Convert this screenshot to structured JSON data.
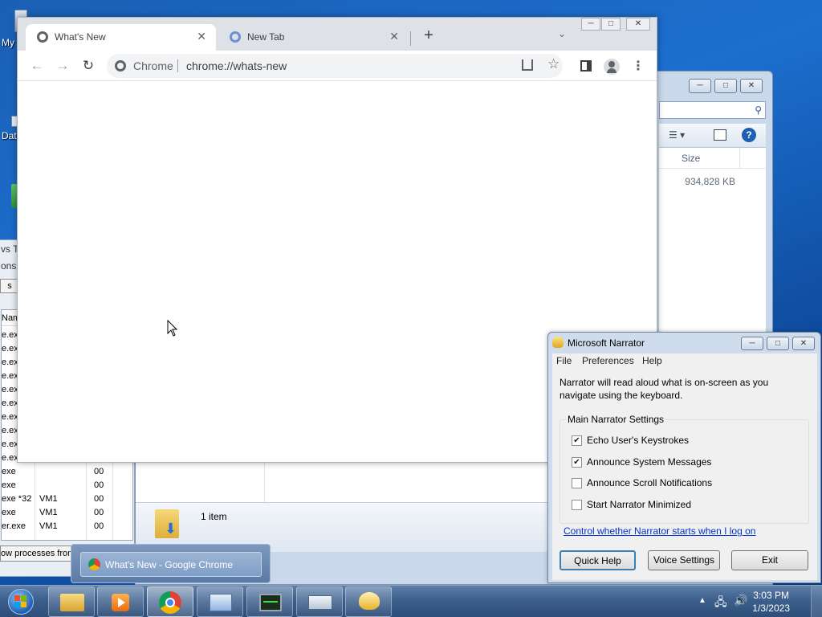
{
  "desktop": {
    "icon_labels": [
      "My",
      "Dat"
    ]
  },
  "task_manager": {
    "title_fragment": "vs Ta",
    "tab_fragment": "ons",
    "button_fragment": "s",
    "column_header": "Nam",
    "rows": [
      {
        "name": "e.exe",
        "user": "",
        "cpu": ""
      },
      {
        "name": "e.exe",
        "user": "",
        "cpu": ""
      },
      {
        "name": "e.exe",
        "user": "",
        "cpu": ""
      },
      {
        "name": "e.exe",
        "user": "",
        "cpu": ""
      },
      {
        "name": "e.exe",
        "user": "",
        "cpu": ""
      },
      {
        "name": "e.exe",
        "user": "",
        "cpu": ""
      },
      {
        "name": "e.exe",
        "user": "",
        "cpu": ""
      },
      {
        "name": "e.exe",
        "user": "",
        "cpu": ""
      },
      {
        "name": "e.exe",
        "user": "",
        "cpu": ""
      },
      {
        "name": "e.exe",
        "user": "",
        "cpu": ""
      },
      {
        "name": "exe",
        "user": "",
        "cpu": "00"
      },
      {
        "name": "exe",
        "user": "",
        "cpu": "00"
      },
      {
        "name": "exe *32",
        "user": "VM1",
        "cpu": "00"
      },
      {
        "name": "exe",
        "user": "VM1",
        "cpu": "00"
      },
      {
        "name": "er.exe",
        "user": "VM1",
        "cpu": "00"
      }
    ],
    "show_processes_label": "ow processes from"
  },
  "explorer": {
    "column_size": "Size",
    "file_size": "934,828 KB",
    "status_items": "1 item"
  },
  "chrome": {
    "tabs": [
      {
        "title": "What's New",
        "active": true
      },
      {
        "title": "New Tab",
        "active": false
      }
    ],
    "new_tab_symbol": "+",
    "omnibox_site": "Chrome",
    "omnibox_url": "chrome://whats-new"
  },
  "narrator": {
    "title": "Microsoft Narrator",
    "menu": [
      "File",
      "Preferences",
      "Help"
    ],
    "description": "Narrator will read aloud what is on-screen as you navigate using the keyboard.",
    "group_title": "Main Narrator Settings",
    "options": [
      {
        "label": "Echo User's Keystrokes",
        "checked": true
      },
      {
        "label": "Announce System Messages",
        "checked": true
      },
      {
        "label": "Announce Scroll Notifications",
        "checked": false
      },
      {
        "label": "Start Narrator Minimized",
        "checked": false
      }
    ],
    "link": "Control whether Narrator starts when I log on",
    "buttons": {
      "quick_help": "Quick Help",
      "voice_settings": "Voice Settings",
      "exit": "Exit"
    }
  },
  "taskbar": {
    "thumbnail_title": "What's New - Google Chrome",
    "clock_time": "3:03 PM",
    "clock_date": "1/3/2023"
  },
  "colors": {
    "chrome_tabstrip": "#dee1e6",
    "narrator_link": "#0033cc",
    "taskbar": "#3c5f8c"
  }
}
